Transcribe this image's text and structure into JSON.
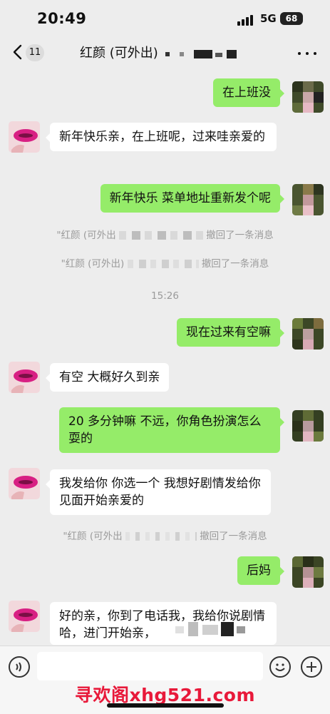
{
  "status_bar": {
    "time": "20:49",
    "network": "5G",
    "battery": "68"
  },
  "nav": {
    "unread_count": "11",
    "title": "红颜 (可外出)"
  },
  "messages": [
    {
      "text": "在上班没"
    },
    {
      "text": "新年快乐亲，在上班呢，过来哇亲爱的"
    },
    {
      "text": "新年快乐  菜单地址重新发个呢"
    },
    {
      "text": "现在过来有空嘛"
    },
    {
      "text": "有空 大概好久到亲"
    },
    {
      "text": "20 多分钟嘛 不远，你角色扮演怎么耍的"
    },
    {
      "text": "我发给你 你选一个 我想好剧情发给你  见面开始亲爱的"
    },
    {
      "text": "后妈"
    },
    {
      "text": "好的亲，你到了电话我，我给你说剧情哈，进门开始亲，"
    }
  ],
  "system_notices": [
    {
      "name": "\"红颜 (可外出",
      "suffix": "撤回了一条消息"
    },
    {
      "name": "\"红颜 (可外出)",
      "suffix": "撤回了一条消息"
    },
    {
      "name": "\"红颜 (可外出",
      "suffix": "撤回了一条消息"
    }
  ],
  "timestamp": "15:26",
  "watermark": "寻欢阁xhg521.com",
  "colors": {
    "outgoing_bubble": "#95ec69",
    "incoming_bubble": "#ffffff",
    "background": "#ededed",
    "watermark": "#e8193a"
  }
}
